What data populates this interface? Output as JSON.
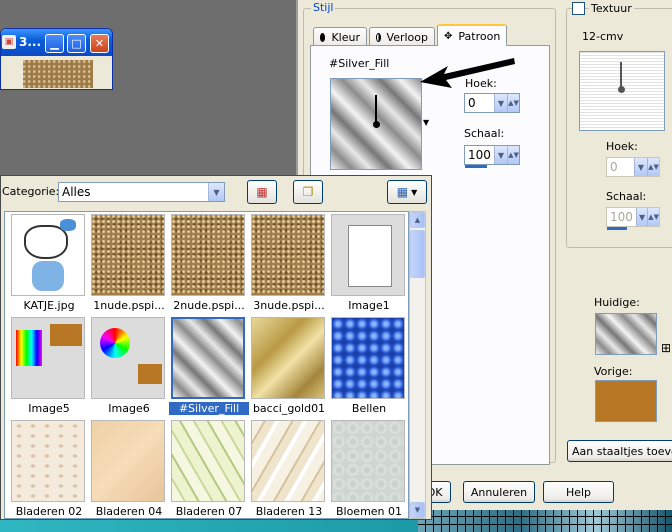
{
  "dialog": {
    "stijl_label": "Stijl",
    "tabs": [
      {
        "label": "Kleur",
        "icon": "filled-circle-icon"
      },
      {
        "label": "Verloop",
        "icon": "half-circle-icon"
      },
      {
        "label": "Patroon",
        "icon": "pattern-dots-icon",
        "active": true
      }
    ],
    "pattern_name": "#Silver_Fill",
    "hoek_label": "Hoek:",
    "hoek_value": "0",
    "schaal_label": "Schaal:",
    "schaal_value": "100",
    "textuur": {
      "label": "Textuur",
      "checked": false,
      "name": "12-cmv",
      "hoek_label": "Hoek:",
      "hoek_value": "0",
      "schaal_label": "Schaal:",
      "schaal_value": "100"
    },
    "huidige_label": "Huidige:",
    "vorige_label": "Vorige:",
    "vorige_color": "#b87724",
    "add_swatch_label": "Aan staaltjes toevoegen",
    "ok_label": "OK",
    "cancel_label": "Annuleren",
    "help_label": "Help"
  },
  "mini_window": {
    "title": "3..."
  },
  "browser": {
    "category_label": "Categorie:",
    "category_value": "Alles",
    "items": [
      {
        "caption": "KATJE.jpg",
        "pattern": "katje"
      },
      {
        "caption": "1nude.pspi...",
        "pattern": "nude"
      },
      {
        "caption": "2nude.pspi...",
        "pattern": "nude"
      },
      {
        "caption": "3nude.pspi...",
        "pattern": "nude"
      },
      {
        "caption": "Image1",
        "pattern": "image1"
      },
      {
        "caption": "Image5",
        "pattern": "image5"
      },
      {
        "caption": "Image6",
        "pattern": "image6"
      },
      {
        "caption": "#Silver_Fill",
        "pattern": "silver",
        "selected": true
      },
      {
        "caption": "bacci_gold01",
        "pattern": "gold"
      },
      {
        "caption": "Bellen",
        "pattern": "bellen"
      },
      {
        "caption": "Bladeren 02",
        "pattern": "blad02"
      },
      {
        "caption": "Bladeren 04",
        "pattern": "blad04"
      },
      {
        "caption": "Bladeren 07",
        "pattern": "blad07"
      },
      {
        "caption": "Bladeren 13",
        "pattern": "blad13"
      },
      {
        "caption": "Bloemen 01",
        "pattern": "bloem"
      }
    ]
  }
}
